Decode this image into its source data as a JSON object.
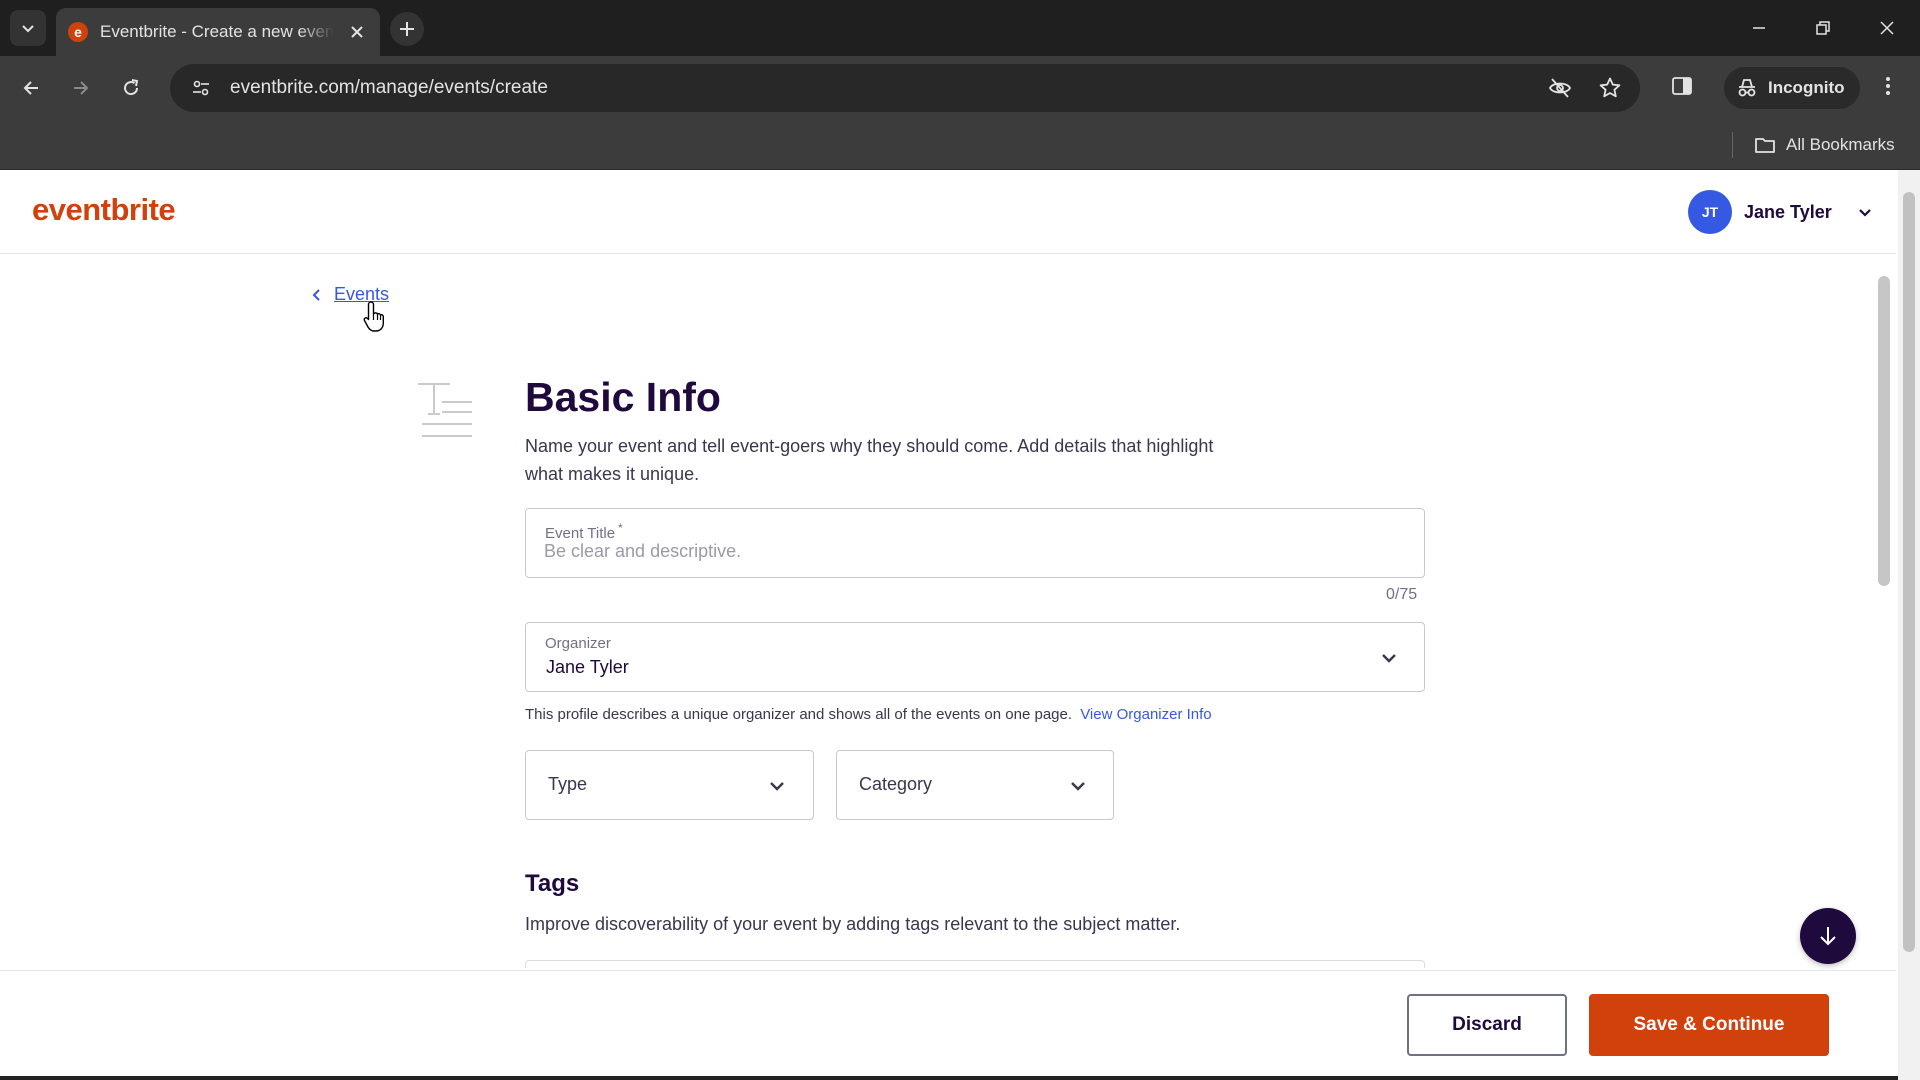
{
  "browser": {
    "tab_title": "Eventbrite - Create a new event",
    "favicon_letter": "e",
    "url": "eventbrite.com/manage/events/create",
    "incognito_label": "Incognito",
    "bookmarks_label": "All Bookmarks"
  },
  "header": {
    "logo": "eventbrite",
    "user_initials": "JT",
    "user_name": "Jane Tyler"
  },
  "nav": {
    "back_label": "Events"
  },
  "basic_info": {
    "title": "Basic Info",
    "description": "Name your event and tell event-goers why they should come. Add details that highlight what makes it unique.",
    "event_title_label": "Event Title",
    "event_title_required": "*",
    "event_title_placeholder": "Be clear and descriptive.",
    "event_title_value": "",
    "char_counter": "0/75",
    "organizer_label": "Organizer",
    "organizer_value": "Jane Tyler",
    "organizer_help": "This profile describes a unique organizer and shows all of the events on one page.",
    "organizer_link": "View Organizer Info",
    "type_label": "Type",
    "category_label": "Category"
  },
  "tags": {
    "title": "Tags",
    "description": "Improve discoverability of your event by adding tags relevant to the subject matter."
  },
  "footer": {
    "discard_label": "Discard",
    "save_label": "Save & Continue"
  },
  "colors": {
    "brand": "#d1410c",
    "link": "#3659e3",
    "heading": "#1e0a3c",
    "avatar": "#3659e3"
  }
}
